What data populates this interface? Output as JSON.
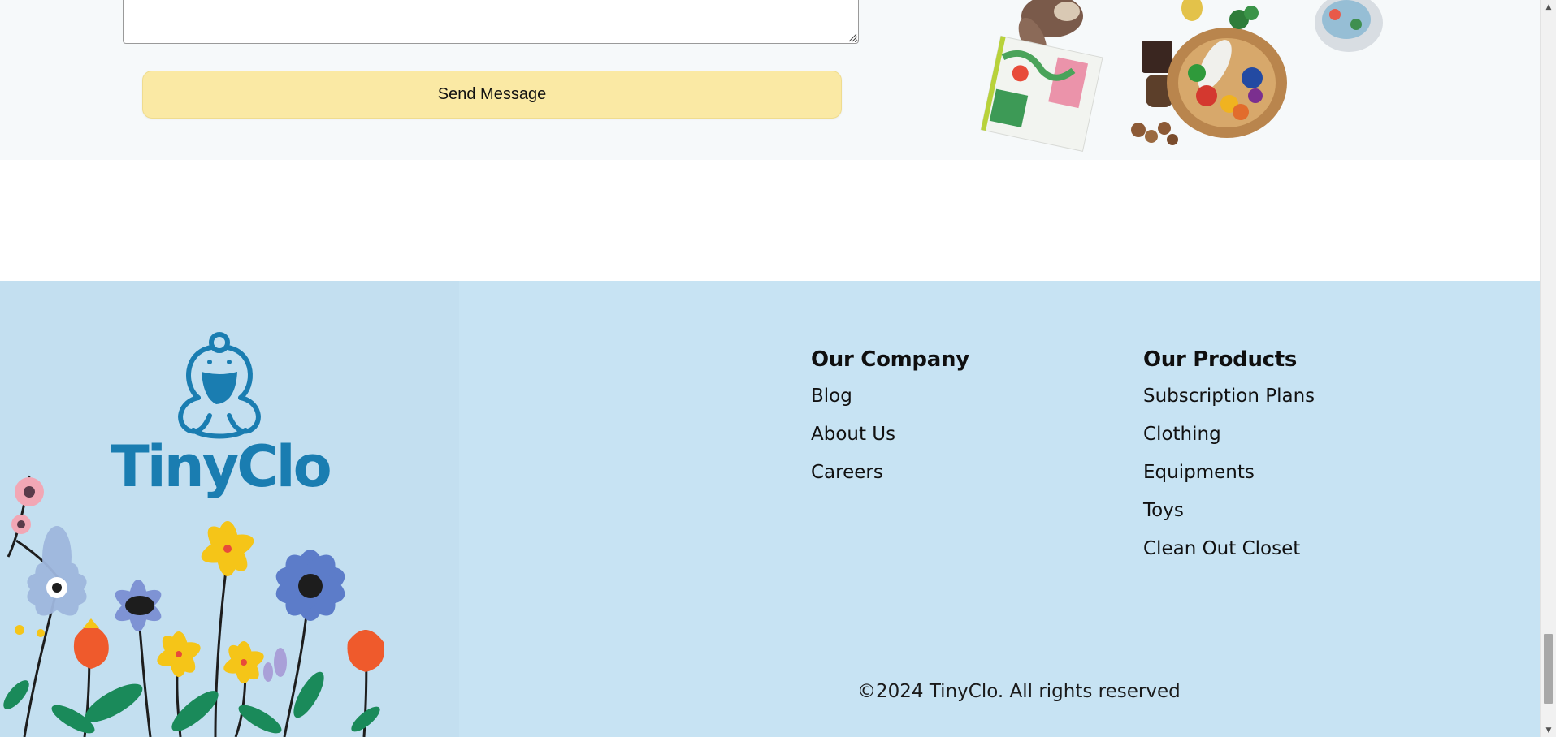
{
  "contact_form": {
    "message_value": "",
    "send_label": "Send Message"
  },
  "footer": {
    "brand": "TinyClo",
    "company_heading": "Our Company",
    "company_links": [
      "Blog",
      "About Us",
      "Careers"
    ],
    "products_heading": "Our Products",
    "product_links": [
      "Subscription Plans",
      "Clothing",
      "Equipments",
      "Toys",
      "Clean Out Closet"
    ],
    "copyright": "©2024 TinyClo. All rights reserved"
  },
  "scrollbar": {
    "up_arrow": "▲",
    "down_arrow": "▼",
    "position_fraction": 0.97
  },
  "colors": {
    "accent": "#1a7db1",
    "footer_bg": "#c7e3f3",
    "button_bg": "#fae9a4"
  },
  "icons": {
    "logo": "frog-mascot-icon",
    "resize": "resize-grip-icon"
  }
}
